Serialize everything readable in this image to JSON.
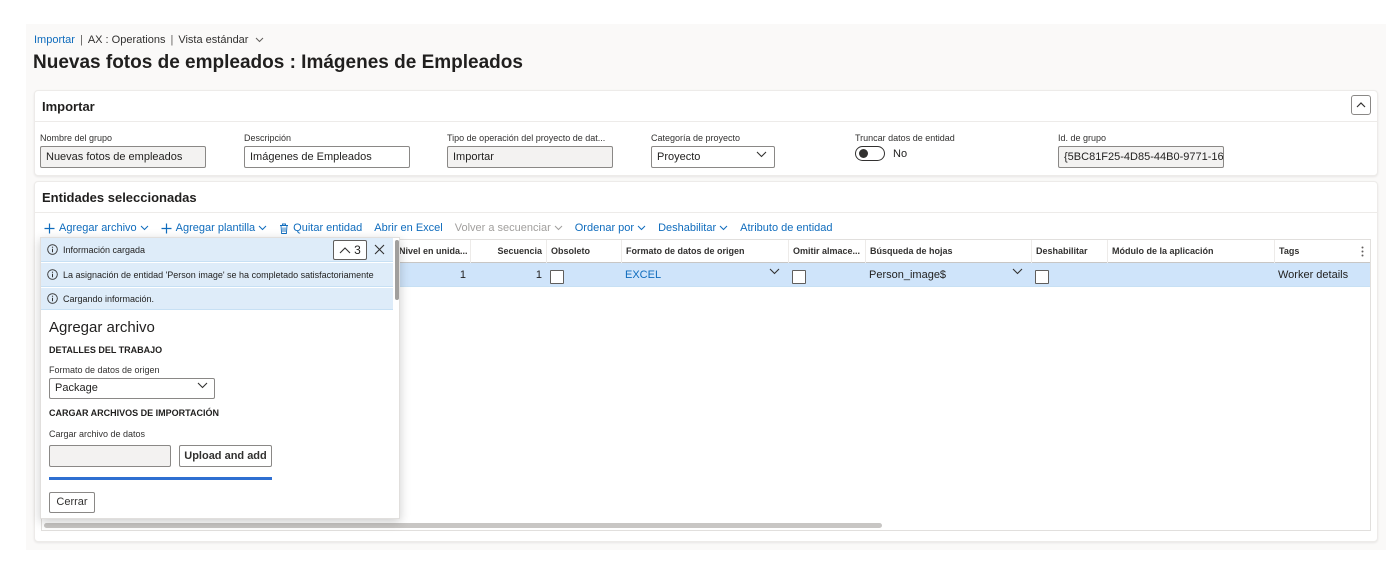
{
  "breadcrumb": [
    "Importar",
    "AX : Operations",
    "Vista estándar"
  ],
  "page_title": "Nuevas fotos de empleados : Imágenes de Empleados",
  "import_panel": {
    "title": "Importar",
    "fields": {
      "group_name": {
        "label": "Nombre del grupo",
        "value": "Nuevas fotos de empleados"
      },
      "description": {
        "label": "Descripción",
        "value": "Imágenes de Empleados"
      },
      "operation_type": {
        "label": "Tipo de operación del proyecto de dat...",
        "value": "Importar"
      },
      "project_category": {
        "label": "Categoría de proyecto",
        "value": "Proyecto"
      },
      "truncate": {
        "label": "Truncar datos de entidad",
        "value": "No"
      },
      "group_id": {
        "label": "Id. de grupo",
        "value": "{5BC81F25-4D85-44B0-9771-16..."
      }
    }
  },
  "entities_panel": {
    "title": "Entidades seleccionadas",
    "toolbar": {
      "add_file": "Agregar archivo",
      "add_template": "Agregar plantilla",
      "remove_entity": "Quitar entidad",
      "open_excel": "Abrir en Excel",
      "resequence": "Volver a secuenciar",
      "sort_by": "Ordenar por",
      "disable": "Deshabilitar",
      "entity_attribute": "Atributo de entidad"
    },
    "columns": {
      "unit_level": "Nivel en unida...",
      "sequence": "Secuencia",
      "obsolete": "Obsoleto",
      "source_format": "Formato de datos de origen",
      "skip_staging": "Omitir almace...",
      "sheet_lookup": "Búsqueda de hojas",
      "disable": "Deshabilitar",
      "app_module": "Módulo de la aplicación",
      "tags": "Tags"
    },
    "row": {
      "unit_level": "1",
      "sequence": "1",
      "source_format": "EXCEL",
      "sheet_lookup": "Person_image$",
      "tags": "Worker details"
    }
  },
  "notifications": {
    "messages": [
      "Información cargada",
      "La asignación de entidad 'Person image' se ha completado satisfactoriamente",
      "Cargando información."
    ],
    "count": "3"
  },
  "add_file_dialog": {
    "title": "Agregar archivo",
    "job_details": "DETALLES DEL TRABAJO",
    "source_format_label": "Formato de datos de origen",
    "source_format_value": "Package",
    "upload_section": "CARGAR ARCHIVOS DE IMPORTACIÓN",
    "upload_label": "Cargar archivo de datos",
    "upload_button": "Upload and add",
    "upload_progress": 1.0,
    "close_button": "Cerrar"
  },
  "colors": {
    "accent": "#0f6cbd",
    "selected_row": "#cfe4fa",
    "message_bar": "#deecf9",
    "progress": "#2f6fd1"
  }
}
